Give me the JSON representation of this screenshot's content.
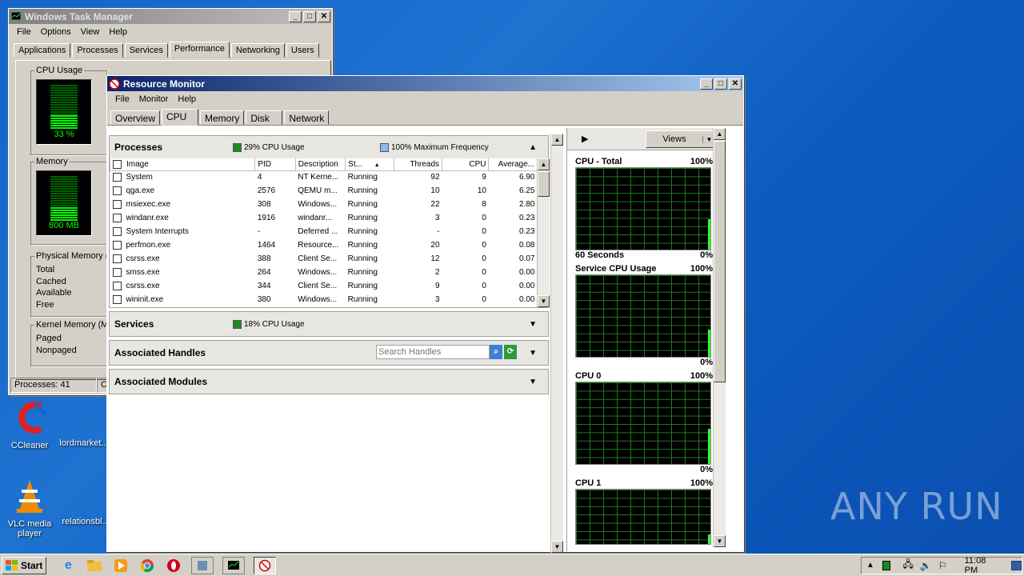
{
  "desktop": {
    "icons": [
      {
        "label": "CCleaner"
      },
      {
        "label": "lordmarket..."
      },
      {
        "label": "VLC media player"
      },
      {
        "label": "relationsbl..."
      }
    ],
    "watermark": "ANY RUN"
  },
  "task_manager": {
    "title": "Windows Task Manager",
    "menu": [
      "File",
      "Options",
      "View",
      "Help"
    ],
    "tabs": [
      "Applications",
      "Processes",
      "Services",
      "Performance",
      "Networking",
      "Users"
    ],
    "selected_tab": "Performance",
    "cpu_usage": {
      "label": "CPU Usage",
      "value": "33 %",
      "fraction": 0.33
    },
    "memory": {
      "label": "Memory",
      "value": "800 MB",
      "fraction": 0.3
    },
    "physical_memory": {
      "label": "Physical Memory (M",
      "rows": [
        "Total",
        "Cached",
        "Available",
        "Free"
      ]
    },
    "kernel_memory": {
      "label": "Kernel Memory (MB",
      "rows": [
        "Paged",
        "Nonpaged"
      ]
    },
    "status": {
      "processes": "Processes: 41",
      "cpu": "CP"
    }
  },
  "resource_monitor": {
    "title": "Resource Monitor",
    "menu": [
      "File",
      "Monitor",
      "Help"
    ],
    "tabs": [
      "Overview",
      "CPU",
      "Memory",
      "Disk",
      "Network"
    ],
    "selected_tab": "CPU",
    "processes": {
      "title": "Processes",
      "cpu_usage": "29% CPU Usage",
      "max_freq": "100% Maximum Frequency",
      "columns": [
        "Image",
        "PID",
        "Description",
        "St...",
        "Threads",
        "CPU",
        "Average..."
      ],
      "rows": [
        {
          "image": "System",
          "pid": "4",
          "desc": "NT Kerne...",
          "status": "Running",
          "threads": "92",
          "cpu": "9",
          "avg": "6.90"
        },
        {
          "image": "qga.exe",
          "pid": "2576",
          "desc": "QEMU m...",
          "status": "Running",
          "threads": "10",
          "cpu": "10",
          "avg": "6.25"
        },
        {
          "image": "msiexec.exe",
          "pid": "308",
          "desc": "Windows...",
          "status": "Running",
          "threads": "22",
          "cpu": "8",
          "avg": "2.80"
        },
        {
          "image": "windanr.exe",
          "pid": "1916",
          "desc": "windanr...",
          "status": "Running",
          "threads": "3",
          "cpu": "0",
          "avg": "0.23"
        },
        {
          "image": "System Interrupts",
          "pid": "-",
          "desc": "Deferred ...",
          "status": "Running",
          "threads": "-",
          "cpu": "0",
          "avg": "0.23"
        },
        {
          "image": "perfmon.exe",
          "pid": "1464",
          "desc": "Resource...",
          "status": "Running",
          "threads": "20",
          "cpu": "0",
          "avg": "0.08"
        },
        {
          "image": "csrss.exe",
          "pid": "388",
          "desc": "Client Se...",
          "status": "Running",
          "threads": "12",
          "cpu": "0",
          "avg": "0.07"
        },
        {
          "image": "smss.exe",
          "pid": "264",
          "desc": "Windows...",
          "status": "Running",
          "threads": "2",
          "cpu": "0",
          "avg": "0.00"
        },
        {
          "image": "csrss.exe",
          "pid": "344",
          "desc": "Client Se...",
          "status": "Running",
          "threads": "9",
          "cpu": "0",
          "avg": "0.00"
        },
        {
          "image": "wininit.exe",
          "pid": "380",
          "desc": "Windows...",
          "status": "Running",
          "threads": "3",
          "cpu": "0",
          "avg": "0.00"
        }
      ]
    },
    "services": {
      "title": "Services",
      "cpu_usage": "18% CPU Usage"
    },
    "handles": {
      "title": "Associated Handles",
      "search_placeholder": "Search Handles"
    },
    "modules": {
      "title": "Associated Modules"
    },
    "graphs": {
      "views_label": "Views",
      "items": [
        {
          "title": "CPU - Total",
          "max": "100%",
          "footer_left": "60 Seconds",
          "min": "0%"
        },
        {
          "title": "Service CPU Usage",
          "max": "100%",
          "footer_left": "",
          "min": "0%"
        },
        {
          "title": "CPU 0",
          "max": "100%",
          "footer_left": "",
          "min": "0%"
        },
        {
          "title": "CPU 1",
          "max": "100%",
          "footer_left": "",
          "min": ""
        }
      ]
    }
  },
  "taskbar": {
    "start_label": "Start",
    "clock": "11:08 PM"
  }
}
